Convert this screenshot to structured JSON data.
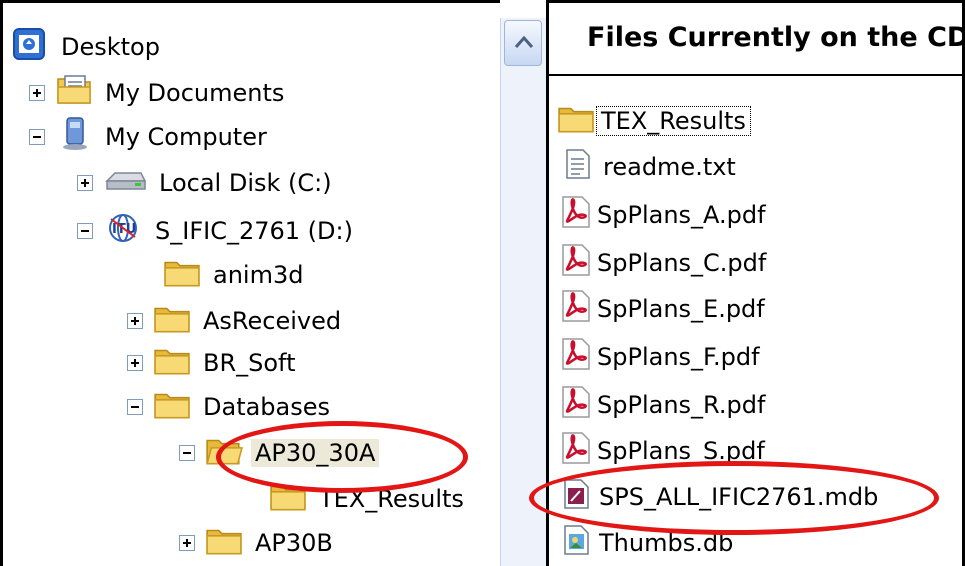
{
  "tree": {
    "items": [
      {
        "label": "Desktop",
        "icon": "desktop-icon"
      },
      {
        "label": "My Documents",
        "icon": "documents-icon"
      },
      {
        "label": "My Computer",
        "icon": "computer-icon"
      },
      {
        "label": "Local Disk (C:)",
        "icon": "drive-icon"
      },
      {
        "label": "S_IFIC_2761 (D:)",
        "icon": "cd-drive-icon"
      },
      {
        "label": "anim3d",
        "icon": "folder-icon"
      },
      {
        "label": "AsReceived",
        "icon": "folder-icon"
      },
      {
        "label": "BR_Soft",
        "icon": "folder-icon"
      },
      {
        "label": "Databases",
        "icon": "folder-icon"
      },
      {
        "label": "AP30_30A",
        "icon": "folder-open-icon"
      },
      {
        "label": "TEX_Results",
        "icon": "folder-icon"
      },
      {
        "label": "AP30B",
        "icon": "folder-icon"
      }
    ]
  },
  "files": {
    "title": "Files Currently on the CD",
    "items": [
      {
        "label": "TEX_Results",
        "icon": "folder-icon"
      },
      {
        "label": "readme.txt",
        "icon": "text-file-icon"
      },
      {
        "label": "SpPlans_A.pdf",
        "icon": "pdf-icon"
      },
      {
        "label": "SpPlans_C.pdf",
        "icon": "pdf-icon"
      },
      {
        "label": "SpPlans_E.pdf",
        "icon": "pdf-icon"
      },
      {
        "label": "SpPlans_F.pdf",
        "icon": "pdf-icon"
      },
      {
        "label": "SpPlans_R.pdf",
        "icon": "pdf-icon"
      },
      {
        "label": "SpPlans_S.pdf",
        "icon": "pdf-icon"
      },
      {
        "label": "SPS_ALL_IFIC2761.mdb",
        "icon": "access-db-icon"
      },
      {
        "label": "Thumbs.db",
        "icon": "thumbs-db-icon"
      }
    ]
  },
  "colors": {
    "highlight_ellipse": "#e31616",
    "folder": "#f5d46a",
    "pdf": "#c8102e"
  }
}
